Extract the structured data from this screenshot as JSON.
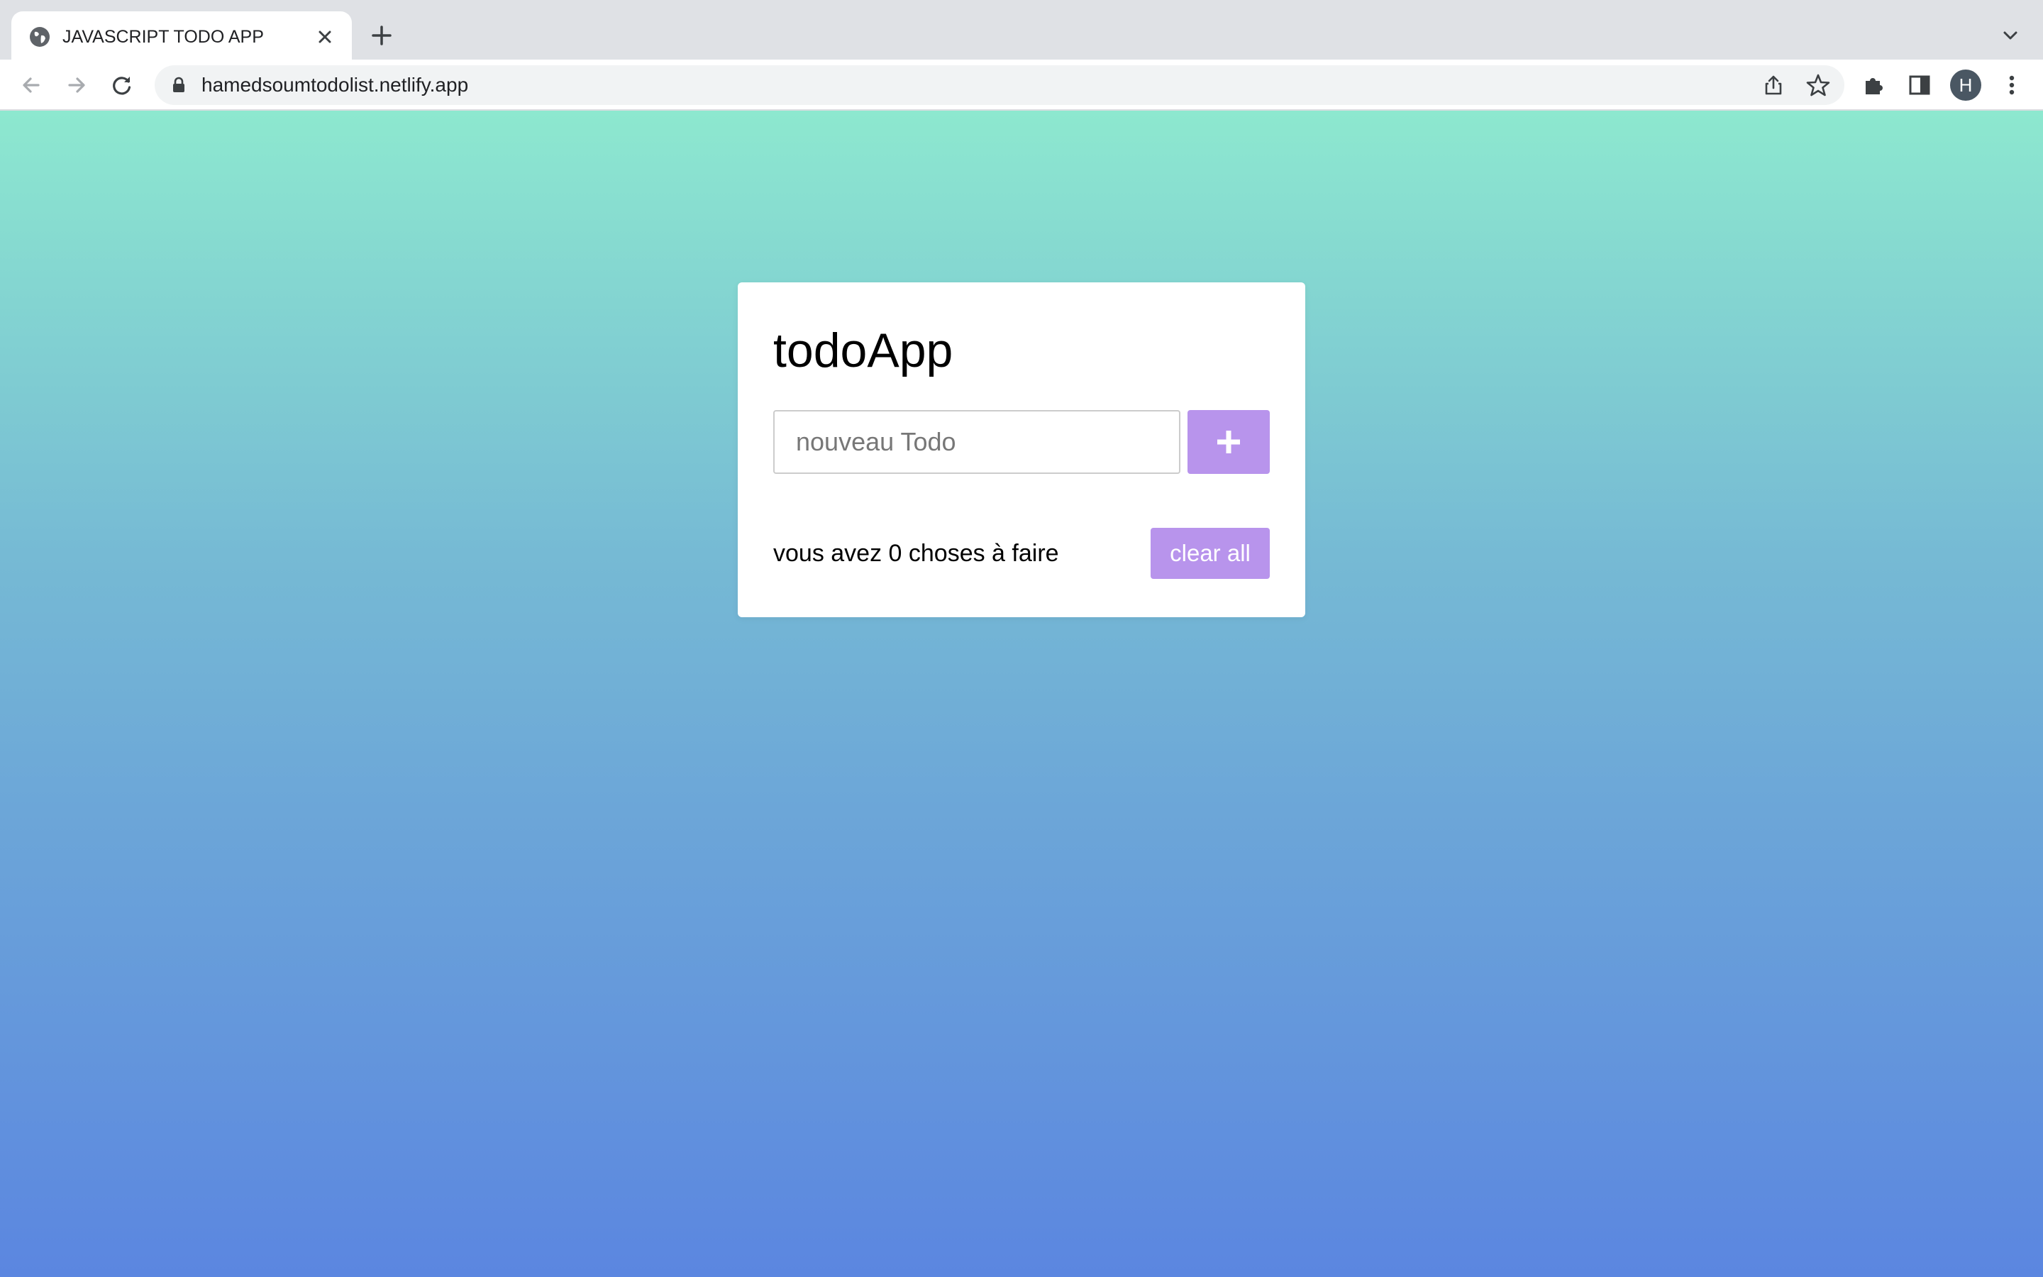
{
  "browser": {
    "tab": {
      "title": "JAVASCRIPT TODO APP",
      "favicon": "globe-icon",
      "close_icon": "close-icon"
    },
    "new_tab_icon": "plus-icon",
    "tab_search_icon": "chevron-down-icon",
    "nav": {
      "back_icon": "arrow-left-icon",
      "forward_icon": "arrow-right-icon",
      "reload_icon": "reload-icon"
    },
    "address_bar": {
      "url": "hamedsoumtodolist.netlify.app",
      "lock_icon": "lock-icon",
      "share_icon": "share-icon",
      "bookmark_icon": "star-icon"
    },
    "toolbar_icons": [
      "puzzle-icon",
      "side-panel-icon",
      "kebab-menu-icon"
    ],
    "profile_initial": "H"
  },
  "app": {
    "title": "todoApp",
    "input": {
      "placeholder": "nouveau Todo",
      "value": ""
    },
    "add_button_icon": "plus-icon",
    "pending_text": "vous avez 0 choses à faire",
    "pending_count": 0,
    "clear_label": "clear all",
    "todos": []
  },
  "colors": {
    "accent": "#b894ec",
    "gradient_top": "#8de8cf",
    "gradient_bottom": "#5b86e0",
    "tabstrip": "#dfe1e5",
    "omnibox": "#f1f3f4",
    "avatar": "#4a5763"
  }
}
